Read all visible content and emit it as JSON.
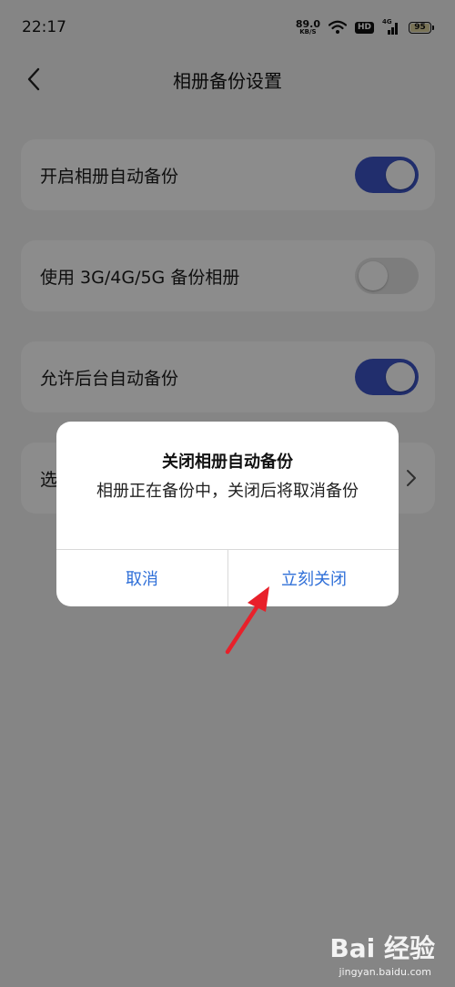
{
  "status_bar": {
    "time": "22:17",
    "net_speed_value": "89.0",
    "net_speed_unit": "KB/S",
    "hd_label": "HD",
    "signal_label": "4G",
    "battery_level": "95",
    "icons": [
      "wifi-icon",
      "hd-icon",
      "signal-icon",
      "battery-icon"
    ]
  },
  "header": {
    "back_icon": "chevron-left-icon",
    "title": "相册备份设置"
  },
  "settings": [
    {
      "label": "开启相册自动备份",
      "toggle_on": true
    },
    {
      "label": "使用 3G/4G/5G 备份相册",
      "toggle_on": false
    },
    {
      "label": "允许后台自动备份",
      "toggle_on": true
    },
    {
      "label": "选",
      "icon": "chevron-right-icon"
    }
  ],
  "dialog": {
    "title": "关闭相册自动备份",
    "message": "相册正在备份中，关闭后将取消备份",
    "cancel_label": "取消",
    "confirm_label": "立刻关闭"
  },
  "watermark": {
    "logo": "Bai 经验",
    "url": "jingyan.baidu.com"
  },
  "colors": {
    "toggle_on": "#3d55c6",
    "dialog_button_text": "#2f6fd8",
    "annotation_arrow": "#e8202a"
  }
}
